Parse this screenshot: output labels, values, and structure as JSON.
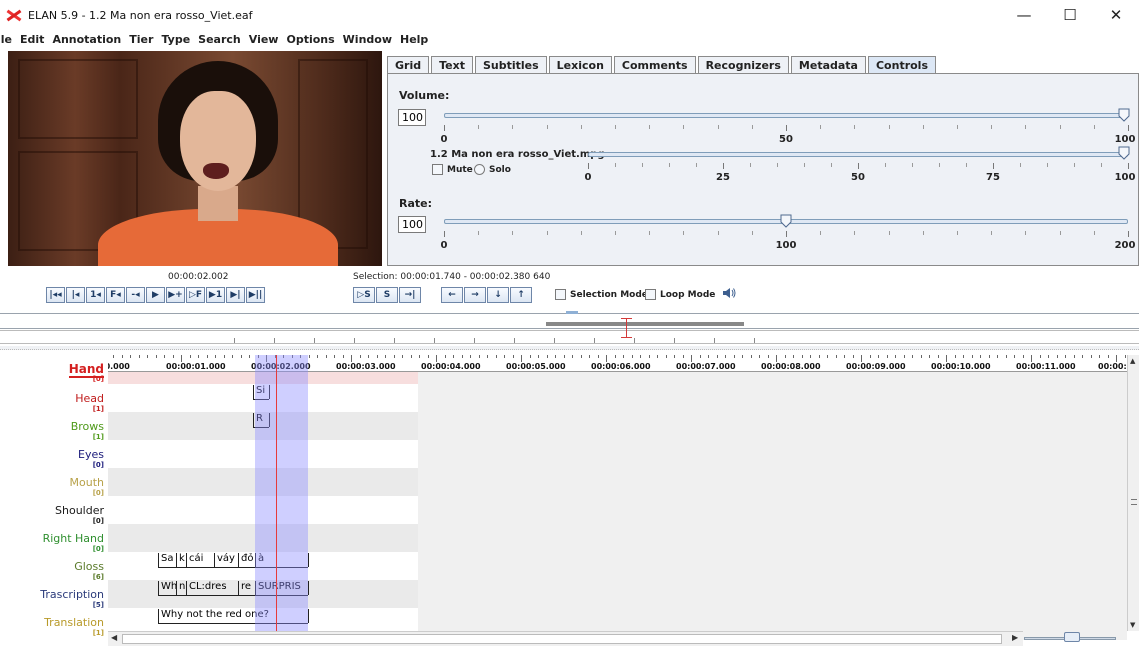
{
  "window": {
    "title": "ELAN 5.9 - 1.2 Ma non era rosso_Viet.eaf",
    "minimize": "—",
    "maximize": "☐",
    "close": "✕"
  },
  "menu": [
    "ile",
    "Edit",
    "Annotation",
    "Tier",
    "Type",
    "Search",
    "View",
    "Options",
    "Window",
    "Help"
  ],
  "tabs": [
    "Grid",
    "Text",
    "Subtitles",
    "Lexicon",
    "Comments",
    "Recognizers",
    "Metadata",
    "Controls"
  ],
  "active_tab": "Controls",
  "controls": {
    "volume_label": "Volume:",
    "volume_value": "100",
    "volume_level": 100,
    "volume_ticks": [
      "0",
      "50",
      "100"
    ],
    "media_file": "1.2 Ma non era rosso_Viet.mpg",
    "media_level": 100,
    "media_ticks": [
      "0",
      "25",
      "50",
      "75",
      "100"
    ],
    "mute_label": "Mute",
    "solo_label": "Solo",
    "rate_label": "Rate:",
    "rate_value": "100",
    "rate_level": 100,
    "rate_ticks": [
      "0",
      "100",
      "200"
    ]
  },
  "player": {
    "current_time": "00:00:02.002",
    "selection": "Selection: 00:00:01.740 - 00:00:02.380  640",
    "buttons": [
      "|◂◂",
      "|◂",
      "1◂",
      "F◂",
      "-◂",
      "▶",
      "▶+",
      "▷F",
      "▶1",
      "▶|",
      "▶||"
    ],
    "selection_buttons": [
      "▷S",
      "S",
      "→|"
    ],
    "nav_buttons": [
      "←",
      "→",
      "↓",
      "↑"
    ],
    "selection_mode_label": "Selection Mode",
    "loop_mode_label": "Loop Mode",
    "volume_icon": "speaker-icon"
  },
  "ruler": {
    "labels": [
      "00.000",
      "00:00:01.000",
      "00:00:02.000",
      "00:00:03.000",
      "00:00:04.000",
      "00:00:05.000",
      "00:00:06.000",
      "00:00:07.000",
      "00:00:08.000",
      "00:00:09.000",
      "00:00:10.000",
      "00:00:11.000",
      "00:00:1"
    ]
  },
  "tiers": [
    {
      "name": "Hand",
      "count": "[0]",
      "color": "#d42020"
    },
    {
      "name": "Head",
      "count": "[1]",
      "color": "#c01c1c"
    },
    {
      "name": "Brows",
      "count": "[1]",
      "color": "#4f9a1a"
    },
    {
      "name": "Eyes",
      "count": "[0]",
      "color": "#1a1a7a"
    },
    {
      "name": "Mouth",
      "count": "[0]",
      "color": "#b8a24a"
    },
    {
      "name": "Shoulder",
      "count": "[0]",
      "color": "#1a1a1a"
    },
    {
      "name": "Right Hand",
      "count": "[0]",
      "color": "#2f8f2f"
    },
    {
      "name": "Gloss",
      "count": "[6]",
      "color": "#5a7a2a"
    },
    {
      "name": "Trascription",
      "count": "[5]",
      "color": "#2a3a7a"
    },
    {
      "name": "Translation",
      "count": "[1]",
      "color": "#b89a2a"
    }
  ],
  "annotations": {
    "head": [
      "Si"
    ],
    "brows": [
      "R"
    ],
    "gloss": [
      "Sa",
      "k",
      "cái",
      "váy",
      "đỏ",
      "à"
    ],
    "transcription": [
      "Wh",
      "n",
      "CL:dres",
      "re",
      "SURPRIS"
    ],
    "translation": [
      "Why not the red one?"
    ]
  }
}
